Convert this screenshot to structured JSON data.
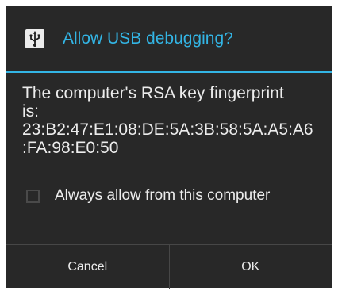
{
  "dialog": {
    "title": "Allow USB debugging?",
    "icon": "usb-icon",
    "message_lines": [
      "The computer's RSA key fingerprint",
      "is:",
      "23:B2:47:E1:08:DE:5A:3B:58:5A:A5:A6",
      ":FA:98:E0:50"
    ],
    "checkbox": {
      "label": "Always allow from this computer",
      "checked": false
    },
    "buttons": {
      "cancel": "Cancel",
      "ok": "OK"
    }
  },
  "colors": {
    "accent": "#33b5e5",
    "dialog_background": "#282828",
    "text": "#ececec",
    "page_background": "#ffffff"
  }
}
